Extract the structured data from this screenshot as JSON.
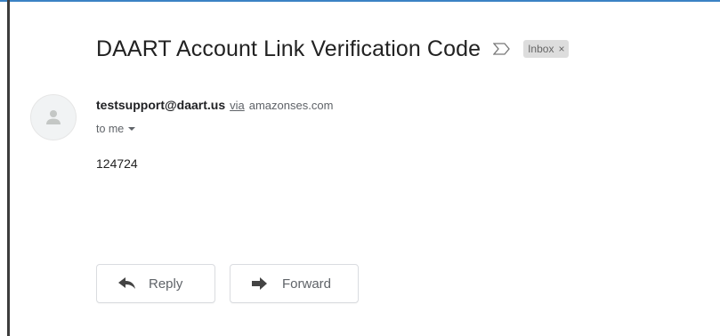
{
  "message": {
    "subject": "DAART Account Link Verification Code",
    "label": "Inbox",
    "label_close": "×",
    "sender_email": "testsupport@daart.us",
    "via": "via",
    "via_domain": "amazonses.com",
    "recipient": "to me",
    "body": "124724"
  },
  "actions": {
    "reply_label": "Reply",
    "forward_label": "Forward"
  },
  "icons": {
    "important": "importance-marker-icon",
    "avatar": "person-avatar-icon",
    "reply": "reply-arrow-icon",
    "forward": "forward-arrow-icon",
    "recipient_details": "caret-down-icon"
  },
  "colors": {
    "subject_text": "#222222",
    "chip_bg": "#dddddd",
    "secondary_text": "#5f6368",
    "button_border": "#dadce0"
  }
}
